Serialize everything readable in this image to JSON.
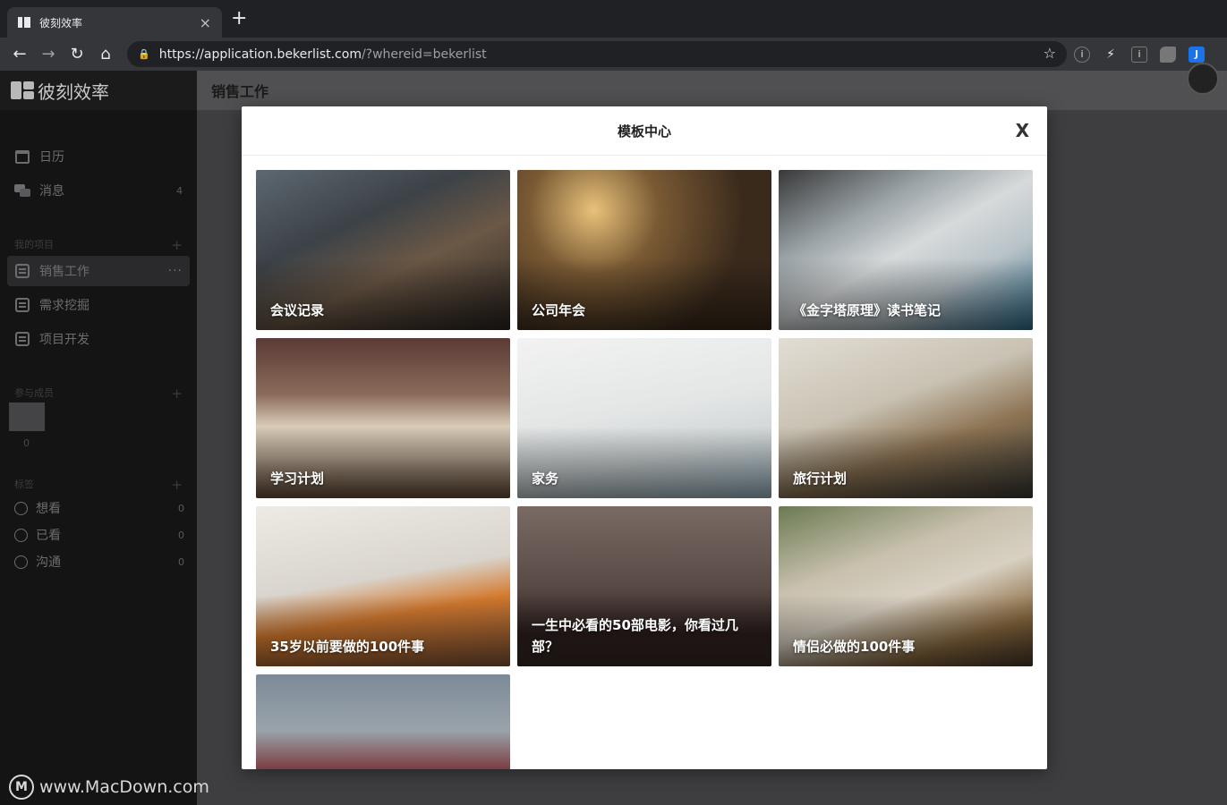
{
  "browser": {
    "tab_title": "彼刻效率",
    "tab_close": "×",
    "new_tab": "+",
    "url_host": "https://application.bekerlist.com",
    "url_rest": "/?whereid=bekerlist",
    "ext_j": "J",
    "ext_i": "i"
  },
  "app": {
    "logo_text": "彼刻效率",
    "nav": [
      {
        "label": "日历",
        "count": ""
      },
      {
        "label": "消息",
        "count": "4"
      }
    ],
    "projects_title": "我的项目",
    "projects": [
      {
        "label": "销售工作",
        "active": true
      },
      {
        "label": "需求挖掘",
        "active": false
      },
      {
        "label": "项目开发",
        "active": false
      }
    ],
    "more_dots": "···",
    "members_title": "参与成员",
    "members_count": "0",
    "tags_title": "标签",
    "tags": [
      {
        "label": "想看",
        "count": "0"
      },
      {
        "label": "已看",
        "count": "0"
      },
      {
        "label": "沟通",
        "count": "0"
      }
    ],
    "plus": "+"
  },
  "main": {
    "header_title": "销售工作"
  },
  "modal": {
    "title": "模板中心",
    "close": "X",
    "cards": [
      {
        "title": "会议记录"
      },
      {
        "title": "公司年会"
      },
      {
        "title": "《金字塔原理》读书笔记"
      },
      {
        "title": "学习计划"
      },
      {
        "title": "家务"
      },
      {
        "title": "旅行计划"
      },
      {
        "title": "35岁以前要做的100件事"
      },
      {
        "title": "一生中必看的50部电影，你看过几部？"
      },
      {
        "title": "情侣必做的100件事"
      },
      {
        "title": ""
      }
    ]
  },
  "watermark": {
    "text": "www.MacDown.com",
    "mark": "M"
  }
}
